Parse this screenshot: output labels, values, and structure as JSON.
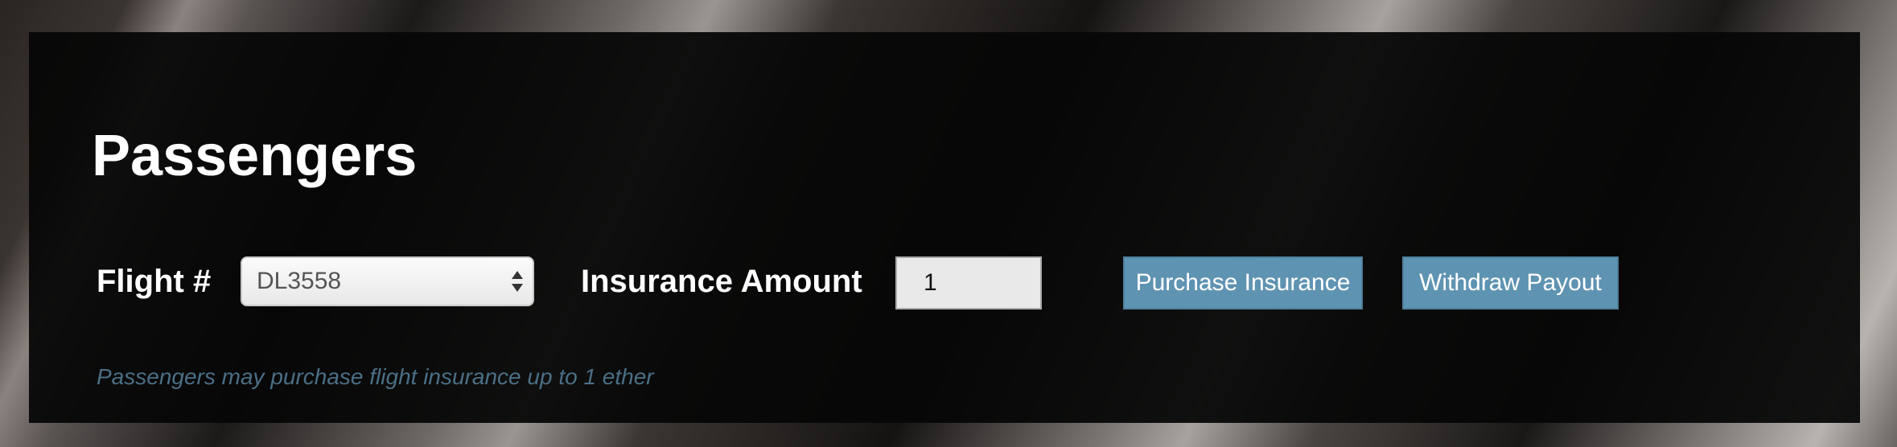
{
  "section": {
    "title": "Passengers"
  },
  "form": {
    "flight_label": "Flight #",
    "flight_selected": "DL3558",
    "amount_label": "Insurance Amount",
    "amount_value": "1",
    "purchase_button": "Purchase Insurance",
    "withdraw_button": "Withdraw Payout",
    "note": "Passengers may purchase flight insurance up to 1 ether"
  },
  "icons": {
    "select_arrows": "updown-arrows-icon"
  },
  "colors": {
    "panel_background": "#060606",
    "button_background": "#5f93b2",
    "note_text": "#4a6f86"
  }
}
